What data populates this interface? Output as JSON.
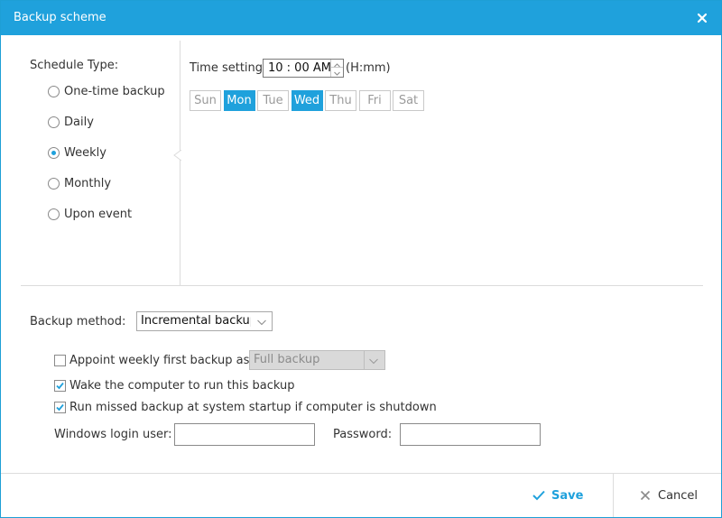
{
  "window": {
    "title": "Backup scheme"
  },
  "schedule": {
    "label": "Schedule Type:",
    "options": [
      {
        "label": "One-time backup",
        "checked": false
      },
      {
        "label": "Daily",
        "checked": false
      },
      {
        "label": "Weekly",
        "checked": true
      },
      {
        "label": "Monthly",
        "checked": false
      },
      {
        "label": "Upon event",
        "checked": false
      }
    ]
  },
  "time": {
    "label": "Time setting",
    "value": "10 : 00  AM",
    "hint": "(H:mm)"
  },
  "days": [
    {
      "label": "Sun",
      "selected": false
    },
    {
      "label": "Mon",
      "selected": true
    },
    {
      "label": "Tue",
      "selected": false
    },
    {
      "label": "Wed",
      "selected": true
    },
    {
      "label": "Thu",
      "selected": false
    },
    {
      "label": "Fri",
      "selected": false
    },
    {
      "label": "Sat",
      "selected": false
    }
  ],
  "backup_method": {
    "label": "Backup method:",
    "value": "Incremental backup"
  },
  "options": {
    "appoint": {
      "label": "Appoint weekly first backup as",
      "checked": false,
      "select_value": "Full backup"
    },
    "wake": {
      "label": "Wake the computer to run this backup",
      "checked": true
    },
    "missed": {
      "label": "Run missed backup at system startup if computer is shutdown",
      "checked": true
    }
  },
  "login": {
    "user_label": "Windows login user:",
    "user_value": "",
    "password_label": "Password:",
    "password_value": ""
  },
  "footer": {
    "save": "Save",
    "cancel": "Cancel"
  },
  "colors": {
    "accent": "#1fa1dc",
    "border": "#dcdcdc"
  }
}
